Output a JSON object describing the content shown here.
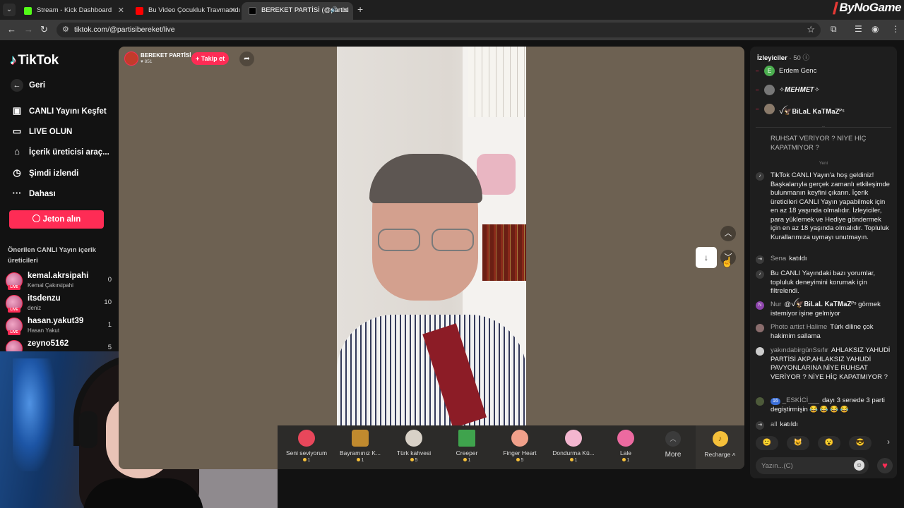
{
  "browser": {
    "tabs": [
      {
        "title": "Stream - Kick Dashboard",
        "favicon_color": "#53fc18",
        "active": false
      },
      {
        "title": "Bu Video Çocukluk Travmamdı",
        "favicon_color": "#ff0000",
        "active": false
      },
      {
        "title": "BEREKET PARTİSİ (@partisi",
        "favicon_color": "#000000",
        "active": true
      }
    ],
    "url": "tiktok.com/@partisibereket/live",
    "brand_overlay": "ByNoGame"
  },
  "sidebar": {
    "logo": "TikTok",
    "back_label": "Geri",
    "items": [
      {
        "label": "CANLI Yayını Keşfet",
        "icon": "explore-live-icon"
      },
      {
        "label": "LIVE OLUN",
        "icon": "camera-icon"
      },
      {
        "label": "İçerik üreticisi araç...",
        "icon": "creator-tools-icon"
      },
      {
        "label": "Şimdi izlendi",
        "icon": "history-icon"
      },
      {
        "label": "Dahası",
        "icon": "more-icon"
      }
    ],
    "coins_button": "Jeton alın",
    "recommended_title": "Önerilen CANLI Yayın içerik üreticileri",
    "creators": [
      {
        "name": "kemal.akrsipahi",
        "sub": "Kemal Çakırsipahi",
        "count": "0"
      },
      {
        "name": "itsdenzu",
        "sub": "deniz",
        "count": "10"
      },
      {
        "name": "hasan.yakut39",
        "sub": "Hasan Yakut",
        "count": "1"
      },
      {
        "name": "zeyno5162",
        "sub": "",
        "count": "5"
      }
    ]
  },
  "stream": {
    "streamer_name": "BEREKET PARTİSİ",
    "likes": "851",
    "follow_label": "+ Takip et",
    "gifts": [
      {
        "name": "Seni seviyorum",
        "price": "1",
        "color": "#e8475b"
      },
      {
        "name": "Bayramınız K...",
        "price": "1",
        "color": "#c08a2e"
      },
      {
        "name": "Türk kahvesi",
        "price": "5",
        "color": "#d8d1c7"
      },
      {
        "name": "Creeper",
        "price": "1",
        "color": "#3fa34d"
      },
      {
        "name": "Finger Heart",
        "price": "5",
        "color": "#f0a08a"
      },
      {
        "name": "Dondurma Kü...",
        "price": "1",
        "color": "#f3b6cf"
      },
      {
        "name": "Lale",
        "price": "1",
        "color": "#ec6aa0"
      }
    ],
    "more_label": "More",
    "recharge_label": "Recharge"
  },
  "chat": {
    "viewers_label": "İzleyiciler",
    "viewers_count": "· 50",
    "viewers": [
      {
        "name": "Erdem Genc",
        "avatar": "E",
        "color": "#4caf50"
      },
      {
        "name": "✧𝑴𝑬𝑯𝑴𝑬𝑻✧",
        "avatar": "",
        "color": "#777777"
      },
      {
        "name": "ꪜ🦅𝐁𝐢𝐋𝐚𝐋 𝐊𝐚𝐓𝐌𝐚𝐙ᴾˢ",
        "avatar": "",
        "color": "#8a7a6a"
      }
    ],
    "top_message": "RUHSAT VERİYOR ? NİYE HİÇ KAPATMIYOR ?",
    "new_label": "Yeni",
    "messages": [
      {
        "user": "",
        "text": "TikTok CANLI Yayın'a hoş geldiniz! Başkalarıyla gerçek zamanlı etkileşimde bulunmanın keyfini çıkarın. İçerik üreticileri CANLI Yayın yapabilmek için en az 18 yaşında olmalıdır. İzleyiciler, para yüklemek ve Hediye göndermek için en az 18 yaşında olmalıdır. Topluluk Kurallarımıza uymayı unutmayın.",
        "icon": "♪"
      },
      {
        "user": "Sena",
        "text": "katıldı",
        "icon": "→"
      },
      {
        "user": "",
        "text": "Bu CANLI Yayındaki bazı yorumlar, topluluk deneyimini korumak için filtrelendi.",
        "icon": "♪"
      },
      {
        "user": "Nur",
        "text": "@ꪜ🦅𝐁𝐢𝐋𝐚𝐋 𝐊𝐚𝐓𝐌𝐚𝐙ᴾˢ görmek istemiyor işine gelmiyor",
        "icon": "N"
      },
      {
        "user": "Photo artist Halime",
        "text": "Türk diline çok hakimim sallama",
        "icon": ""
      },
      {
        "user": "yakındabirgünSsıfır",
        "text": "AHLAKSIZ YAHUDİ PARTİSİ AKP,AHLAKSIZ YAHUDİ PAVYONLARINA NİYE RUHSAT VERİYOR ? NİYE HİÇ KAPATMIYOR ?",
        "icon": ""
      },
      {
        "user": "_ESKİCİ___",
        "level": "16",
        "text": "dayı 3 senede 3 parti degiştirmişin 😂 😂 😂 😂",
        "icon": ""
      },
      {
        "user": "all",
        "text": "katıldı",
        "icon": "→"
      }
    ],
    "emojis": [
      "🙂",
      "😺",
      "😮",
      "😎"
    ],
    "input_placeholder": "Yazın...(C)"
  }
}
